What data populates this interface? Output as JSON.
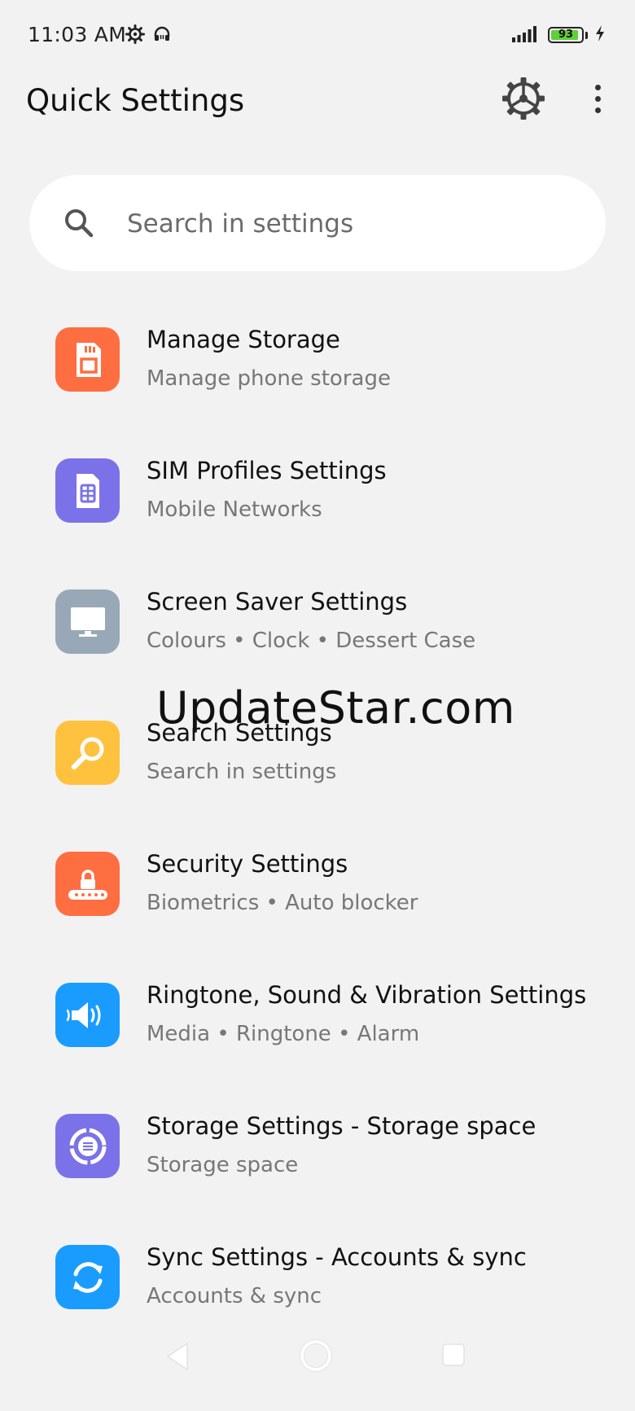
{
  "status_bar": {
    "time": "11:03 AM",
    "battery_level": "93",
    "battery_fraction": 0.93
  },
  "header": {
    "title": "Quick Settings"
  },
  "search": {
    "placeholder": "Search in settings",
    "value": ""
  },
  "items": [
    {
      "title": "Manage Storage",
      "subtitle": "Manage phone storage",
      "icon": "sd-card-icon",
      "color": "#FF6E40"
    },
    {
      "title": "SIM Profiles Settings",
      "subtitle": "Mobile Networks",
      "icon": "sim-card-icon",
      "color": "#7B72E9"
    },
    {
      "title": "Screen Saver Settings",
      "subtitle": "Colours • Clock • Dessert Case",
      "icon": "monitor-icon",
      "color": "#98A8B6"
    },
    {
      "title": "Search Settings",
      "subtitle": "Search in settings",
      "icon": "magnifier-icon",
      "color": "#FFC23F"
    },
    {
      "title": "Security Settings",
      "subtitle": "Biometrics • Auto blocker",
      "icon": "lock-password-icon",
      "color": "#FF6E40"
    },
    {
      "title": "Ringtone, Sound & Vibration Settings",
      "subtitle": "Media • Ringtone • Alarm",
      "icon": "speaker-icon",
      "color": "#1A9CFF"
    },
    {
      "title": "Storage Settings - Storage space",
      "subtitle": "Storage space",
      "icon": "storage-circle-icon",
      "color": "#7B72E9"
    },
    {
      "title": "Sync Settings - Accounts & sync",
      "subtitle": "Accounts & sync",
      "icon": "sync-icon",
      "color": "#1A9CFF"
    }
  ],
  "watermark": "UpdateStar.com"
}
